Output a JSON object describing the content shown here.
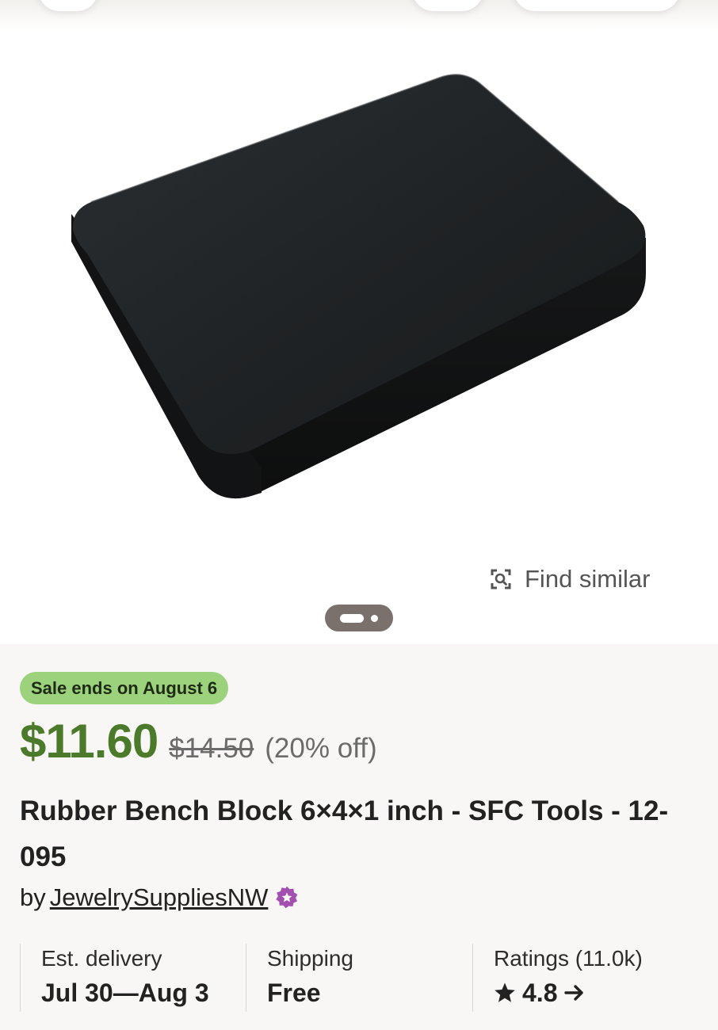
{
  "image_area": {
    "find_similar_label": "Find similar",
    "find_similar_icon": "visual-search-icon",
    "pager_icon": "carousel-indicator"
  },
  "sale": {
    "badge": "Sale ends on August 6",
    "badge_color": "#9dd27d"
  },
  "price": {
    "current": "$11.60",
    "original": "$14.50",
    "discount": "(20% off)",
    "current_color": "#4b7a2b"
  },
  "product": {
    "title": "Rubber Bench Block 6×4×1 inch - SFC Tools - 12-095"
  },
  "seller": {
    "prefix": "by",
    "name": "JewelrySuppliesNW",
    "badge_icon": "star-seller-icon",
    "badge_color": "#a24fb0"
  },
  "stats": {
    "delivery": {
      "label": "Est. delivery",
      "value": "Jul 30—Aug 3"
    },
    "shipping": {
      "label": "Shipping",
      "value": "Free"
    },
    "ratings": {
      "label": "Ratings (11.0k)",
      "value": "4.8",
      "icon": "star-icon",
      "arrow_icon": "arrow-right-icon"
    }
  }
}
